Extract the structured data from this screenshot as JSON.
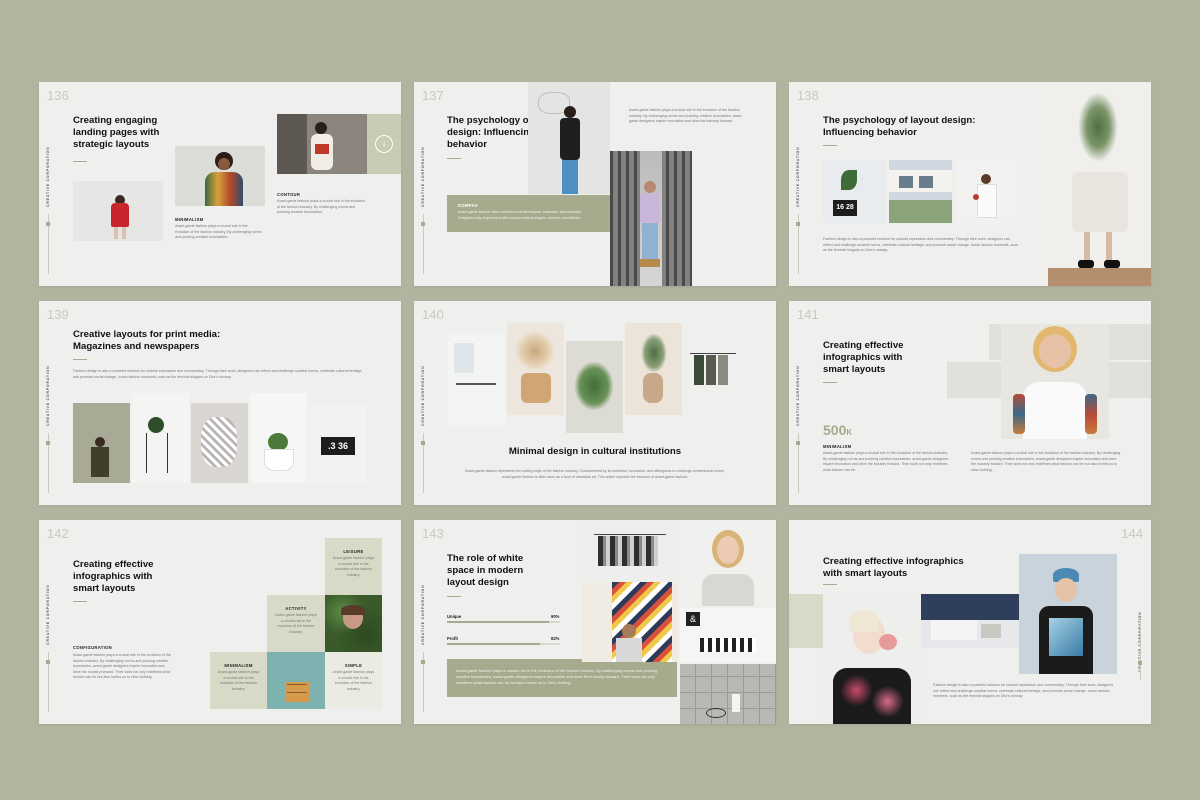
{
  "brand_vertical": "CREATIVE CORPORATION",
  "slides": {
    "s136": {
      "num": "136",
      "title": "Creating engaging landing pages with strategic layouts",
      "label1": "MINIMALISM",
      "body1": "Avant-garde fashion plays a crucial role in the evolution of the fashion industry. By challenging norms and pushing creative boundaries.",
      "label2": "CONTOUR",
      "body2": "Avant-garde fashion plays a crucial role in the evolution of the fashion industry. By challenging norms and pushing creative boundaries."
    },
    "s137": {
      "num": "137",
      "title": "The psychology of layout design: Influencing behavior",
      "body": "Avant-garde fashion plays a crucial role in the evolution of the fashion industry. By challenging norms and pushing creative boundaries, avant-garde designers inspire innovation and drive the industry forward.",
      "box_label": "KOMPAS",
      "box_body": "Avant-garde fashion often involves novel techniques, materials, and concepts. Designers may experiment with unconventional shapes, textures, and fabrics."
    },
    "s138": {
      "num": "138",
      "title": "The psychology of layout design: Influencing behavior",
      "clock": "16 28",
      "body": "Fashion design is also a powerful medium for cultural expression and commentary. Through their work, designers can reflect and challenge societal norms, celebrate cultural heritage, and promote social change. Iconic fashion moments, such as the feminist slogans on Dior's runway."
    },
    "s139": {
      "num": "139",
      "title": "Creative layouts for print media: Magazines and newspapers",
      "clock": ".3 36",
      "body": "Fashion design is also a powerful medium for cultural expression and commentary. Through their work, designers can reflect and challenge societal norms, celebrate cultural heritage, and promote social change. Iconic fashion moments, such as the feminist slogans on Dior's runway."
    },
    "s140": {
      "num": "140",
      "title": "Minimal design in cultural institutions",
      "body": "Avant-garde fashion represents the cutting edge of the fashion industry. Characterized by its boldness, innovation, and willingness to challenge conventional norms, avant-garde fashion is often seen as a form of wearable art. This article explores the essence of avant-garde fashion."
    },
    "s141": {
      "num": "141",
      "title": "Creating effective infographics with smart layouts",
      "stat": "500",
      "stat_unit": "K",
      "label": "MINIMALISM",
      "body1": "Avant-garde fashion plays a crucial role in the evolution of the fashion industry. By challenging norms and pushing creative boundaries, avant-garde designers inspire innovation and drive the industry forward. Their work not only redefines what fashion can be.",
      "body2": "Avant-garde fashion plays a crucial role in the evolution of the fashion industry. By challenging norms and pushing creative boundaries, avant-garde designers inspire innovation and drive the industry forward. Their work not only redefines what fashion can be but also invites us to view clothing."
    },
    "s142": {
      "num": "142",
      "title": "Creating effective infographics with smart layouts",
      "config_label": "CONFIGURATION",
      "config_body": "Avant-garde fashion plays a crucial role in the evolution of the fashion industry. By challenging norms and pushing creative boundaries, avant-garde designers inspire innovation and drive the industry forward. Their work not only redefines what fashion can be but also invites us to view clothing.",
      "leisure": "LEISURE",
      "activity": "ACTIVITY",
      "minimalism": "MINIMALISM",
      "simple": "SIMPLE",
      "cell_body": "Avant-garde fashion plays a crucial role in the evolution of the fashion industry."
    },
    "s143": {
      "num": "143",
      "title": "The role of white space in modern layout design",
      "bar1_label": "Unique",
      "bar1_value": "90%",
      "bar1_pct": 90,
      "bar2_label": "Profit",
      "bar2_value": "82%",
      "bar2_pct": 82,
      "box_body": "Avant-garde fashion plays a crucial role in the evolution of the fashion industry. By challenging norms and pushing creative boundaries, avant-garde designers inspire innovation and drive the industry forward. Their work not only redefines what fashion can be but also invites us to view clothing."
    },
    "s144": {
      "num": "144",
      "title": "Creating effective infographics with smart layouts",
      "body": "Fashion design is also a powerful medium for cultural expression and commentary. Through their work, designers can reflect and challenge societal norms, celebrate cultural heritage, and promote social change. Iconic fashion moments, such as the feminist slogans on Dior's runway."
    }
  },
  "colors": {
    "background": "#b3b4a0",
    "slide": "#efefed",
    "accent": "#a7ab8e",
    "title": "#111111"
  }
}
